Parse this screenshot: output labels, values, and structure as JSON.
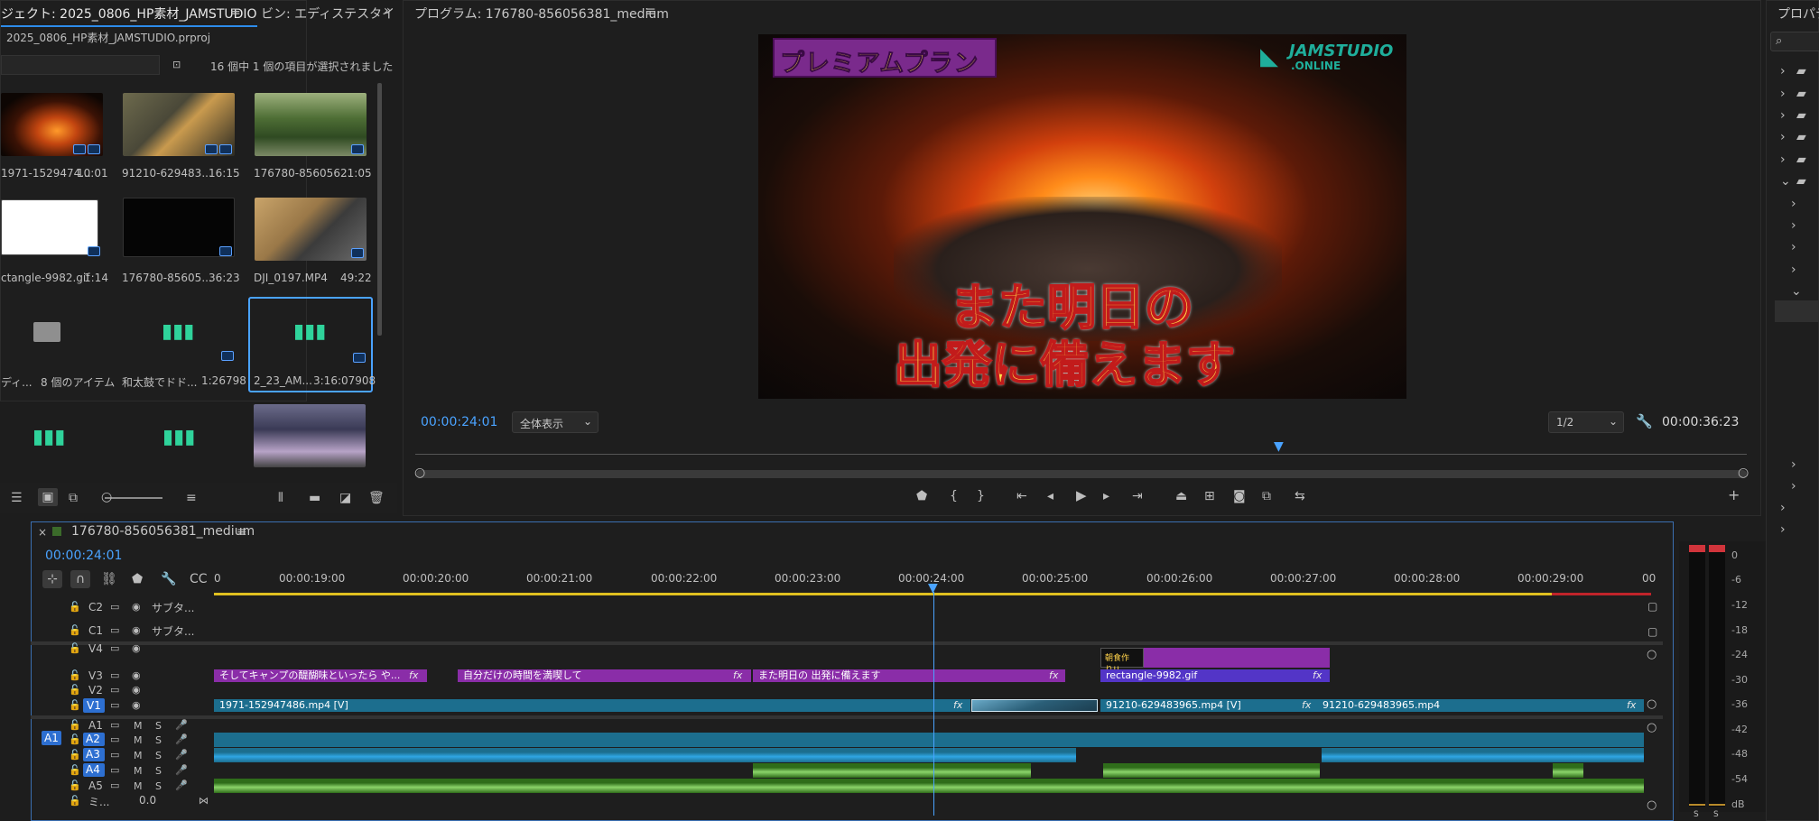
{
  "project_panel": {
    "tab_project": "ジェクト: 2025_0806_HP素材_JAMSTUDIO",
    "tab_bin": "ビン: エディステスタイ",
    "filename": "2025_0806_HP素材_JAMSTUDIO.prproj",
    "selection_status": "16 個中 1 個の項目が選択されました",
    "items": [
      {
        "name": "1971-1529474...",
        "duration": "10:01"
      },
      {
        "name": "91210-629483...",
        "duration": "16:15"
      },
      {
        "name": "176780-856056...",
        "duration": "21:05"
      },
      {
        "name": "ctangle-9982.gif",
        "duration": "1:14"
      },
      {
        "name": "176780-85605...",
        "duration": "36:23"
      },
      {
        "name": "DJI_0197.MP4",
        "duration": "49:22"
      },
      {
        "name": "ディ...",
        "duration": "8 個のアイテム"
      },
      {
        "name": "和太鼓でドド...",
        "duration": "1:26798"
      },
      {
        "name": "2_23_AM...",
        "duration": "3:16:07908"
      }
    ]
  },
  "program_monitor": {
    "tab": "プログラム: 176780-856056381_medium",
    "current_time": "00:00:24:01",
    "fit": "全体表示",
    "resolution": "1/2",
    "duration": "00:00:36:23",
    "overlay_banner": "プレミアムプラン",
    "logo_top": "JAMSTUDIO",
    "logo_bottom": ".ONLINE",
    "caption_line1": "また明日の",
    "caption_line2": "出発に備えます"
  },
  "properties_panel": {
    "tab": "プロパティ"
  },
  "timeline": {
    "sequence_name": "176780-856056381_medium",
    "current_time": "00:00:24:01",
    "ruler_labels": [
      "0",
      "00:00:19:00",
      "00:00:20:00",
      "00:00:21:00",
      "00:00:22:00",
      "00:00:23:00",
      "00:00:24:00",
      "00:00:25:00",
      "00:00:26:00",
      "00:00:27:00",
      "00:00:28:00",
      "00:00:29:00",
      "00"
    ],
    "tracks": {
      "c2": "C2",
      "c1": "C1",
      "v4": "V4",
      "v3": "V3",
      "v2": "V2",
      "v1": "V1",
      "a1": "A1",
      "a2": "A2",
      "a3": "A3",
      "a4": "A4",
      "a5": "A5",
      "mix": "ミ...",
      "mix_val": "0.0",
      "subtitle": "サブタ..."
    },
    "clips": {
      "v3_1": "そしてキャンプの醍醐味といったら や...",
      "v3_2": "自分だけの時間を満喫して",
      "v3_3": "また明日の 出発に備えます",
      "v3_4": "rectangle-9982.gif",
      "v4_1": "朝食作り!!",
      "v1_1": "1971-152947486.mp4 [V]",
      "v1_2": "91210-629483965.mp4 [V]",
      "v1_3": "91210-629483965.mp4",
      "fx": "fx"
    },
    "buttons": {
      "mute": "M",
      "solo": "S"
    }
  },
  "audio_meter": {
    "labels": [
      "0",
      "-6",
      "-12",
      "-18",
      "-24",
      "-30",
      "-36",
      "-42",
      "-48",
      "-54"
    ],
    "db": "dB",
    "s": "S"
  }
}
